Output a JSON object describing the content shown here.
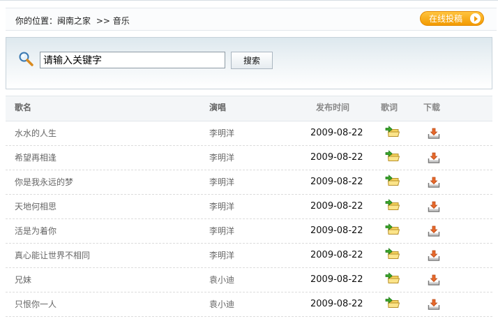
{
  "breadcrumb": {
    "prefix": "你的位置：",
    "home": "闽南之家",
    "separator": ">>",
    "current": "音乐"
  },
  "submit_button": {
    "label": "在线投稿"
  },
  "search": {
    "input_value": "请输入关键字",
    "button_label": "搜索"
  },
  "table": {
    "headers": {
      "name": "歌名",
      "singer": "演唱",
      "date": "发布时间",
      "lyrics": "歌词",
      "download": "下载"
    },
    "rows": [
      {
        "name": "水水的人生",
        "singer": "李明洋",
        "date": "2009-08-22"
      },
      {
        "name": "希望再相逢",
        "singer": "李明洋",
        "date": "2009-08-22"
      },
      {
        "name": "你是我永远的梦",
        "singer": "李明洋",
        "date": "2009-08-22"
      },
      {
        "name": "天地何相思",
        "singer": "李明洋",
        "date": "2009-08-22"
      },
      {
        "name": "活是为着你",
        "singer": "李明洋",
        "date": "2009-08-22"
      },
      {
        "name": "真心能让世界不相同",
        "singer": "李明洋",
        "date": "2009-08-22"
      },
      {
        "name": "兄妹",
        "singer": "袁小迪",
        "date": "2009-08-22"
      },
      {
        "name": "只恨你一人",
        "singer": "袁小迪",
        "date": "2009-08-22"
      }
    ]
  },
  "icons": {
    "search": "magnifier-icon",
    "lyrics": "folder-arrow-icon",
    "download": "download-tray-icon",
    "submit": "play-arrow-icon"
  },
  "colors": {
    "accent_orange": "#f29a00",
    "lyrics_green": "#3aa52a",
    "lyrics_folder": "#f4d35e",
    "download_orange": "#e8692b"
  }
}
